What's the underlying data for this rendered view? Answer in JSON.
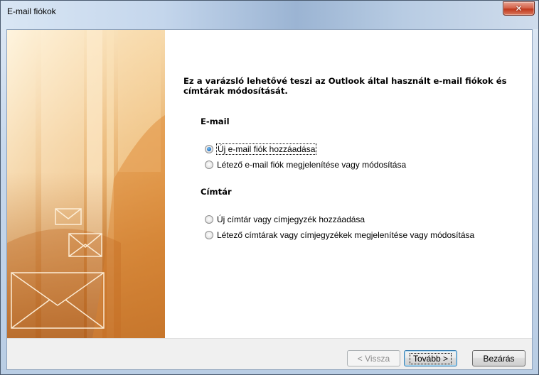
{
  "window": {
    "title": "E-mail fiókok"
  },
  "wizard": {
    "intro": "Ez a varázsló lehetővé teszi az Outlook által használt e-mail fiókok és címtárak módosítását.",
    "email_section": {
      "title": "E-mail",
      "options": [
        {
          "label": "Új e-mail fiók hozzáadása",
          "checked": true
        },
        {
          "label": "Létező e-mail fiók megjelenítése vagy módosítása",
          "checked": false
        }
      ]
    },
    "directory_section": {
      "title": "Címtár",
      "options": [
        {
          "label": "Új címtár vagy címjegyzék hozzáadása",
          "checked": false
        },
        {
          "label": "Létező címtárak vagy címjegyzékek megjelenítése vagy módosítása",
          "checked": false
        }
      ]
    }
  },
  "buttons": {
    "back": "< Vissza",
    "next": "Tovább >",
    "close": "Bezárás"
  },
  "colors": {
    "art_orange": "#d98a3a",
    "radio_selected": "#2b78c6",
    "close_red": "#c0391e"
  }
}
